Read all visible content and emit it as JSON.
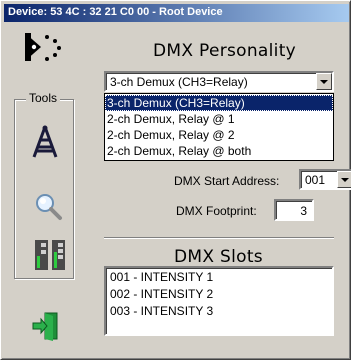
{
  "window": {
    "title": "Device:  53 4C : 32 21 C0 00 - Root Device"
  },
  "sidebar": {
    "tools_label": "Tools"
  },
  "personality": {
    "heading": "DMX Personality",
    "selected": "3-ch Demux (CH3=Relay)",
    "options": [
      "3-ch Demux (CH3=Relay)",
      "2-ch Demux, Relay @ 1",
      "2-ch Demux, Relay @ 2",
      "2-ch Demux, Relay @ both"
    ]
  },
  "start_address": {
    "label": "DMX Start Address:",
    "value": "001"
  },
  "footprint": {
    "label": "DMX Footprint:",
    "value": "3"
  },
  "slots": {
    "heading": "DMX Slots",
    "items": [
      "001 - INTENSITY 1",
      "002 - INTENSITY 2",
      "003 - INTENSITY 3"
    ]
  }
}
